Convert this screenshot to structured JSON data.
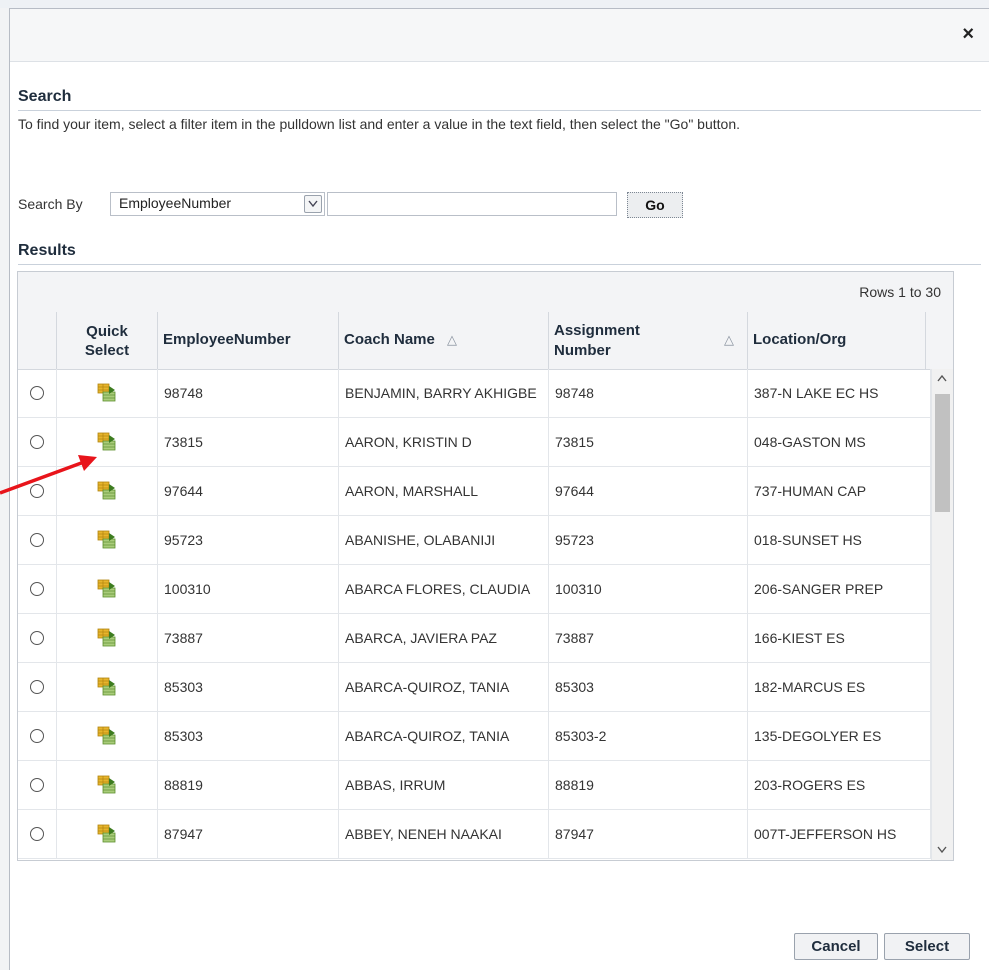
{
  "dialog": {
    "close_label": "×"
  },
  "search": {
    "title": "Search",
    "instructions": "To find your item, select a filter item in the pulldown list and enter a value in the text field, then select the \"Go\" button.",
    "search_by_label": "Search By",
    "selected_filter": "EmployeeNumber",
    "query_value": "",
    "go_label": "Go"
  },
  "results": {
    "title": "Results",
    "rows_range": "Rows 1 to 30",
    "columns": {
      "quick_select": "Quick Select",
      "employee_number": "EmployeeNumber",
      "coach_name": "Coach Name",
      "assignment_number": "Assignment Number",
      "location_org": "Location/Org"
    },
    "rows": [
      {
        "employee_number": "98748",
        "coach_name": "BENJAMIN, BARRY AKHIGBE",
        "assignment_number": "98748",
        "location_org": "387-N LAKE EC HS"
      },
      {
        "employee_number": "73815",
        "coach_name": "AARON, KRISTIN D",
        "assignment_number": "73815",
        "location_org": "048-GASTON MS"
      },
      {
        "employee_number": "97644",
        "coach_name": "AARON, MARSHALL",
        "assignment_number": "97644",
        "location_org": "737-HUMAN CAP"
      },
      {
        "employee_number": "95723",
        "coach_name": "ABANISHE, OLABANIJI",
        "assignment_number": "95723",
        "location_org": "018-SUNSET HS"
      },
      {
        "employee_number": "100310",
        "coach_name": "ABARCA FLORES, CLAUDIA",
        "assignment_number": "100310",
        "location_org": "206-SANGER PREP"
      },
      {
        "employee_number": "73887",
        "coach_name": "ABARCA, JAVIERA PAZ",
        "assignment_number": "73887",
        "location_org": "166-KIEST ES"
      },
      {
        "employee_number": "85303",
        "coach_name": "ABARCA-QUIROZ, TANIA",
        "assignment_number": "85303",
        "location_org": "182-MARCUS ES"
      },
      {
        "employee_number": "85303",
        "coach_name": "ABARCA-QUIROZ, TANIA",
        "assignment_number": "85303-2",
        "location_org": "135-DEGOLYER ES"
      },
      {
        "employee_number": "88819",
        "coach_name": "ABBAS, IRRUM",
        "assignment_number": "88819",
        "location_org": "203-ROGERS ES"
      },
      {
        "employee_number": "87947",
        "coach_name": "ABBEY, NENEH NAAKAI",
        "assignment_number": "87947",
        "location_org": "007T-JEFFERSON HS"
      }
    ]
  },
  "footer": {
    "cancel_label": "Cancel",
    "select_label": "Select"
  },
  "colors": {
    "annotation_arrow": "#e8141b",
    "scroll_thumb": "#c1c1c1"
  },
  "icons": {
    "quick_select": "quick-select-icon",
    "sort": "sort-triangle-icon",
    "close": "close-icon"
  }
}
